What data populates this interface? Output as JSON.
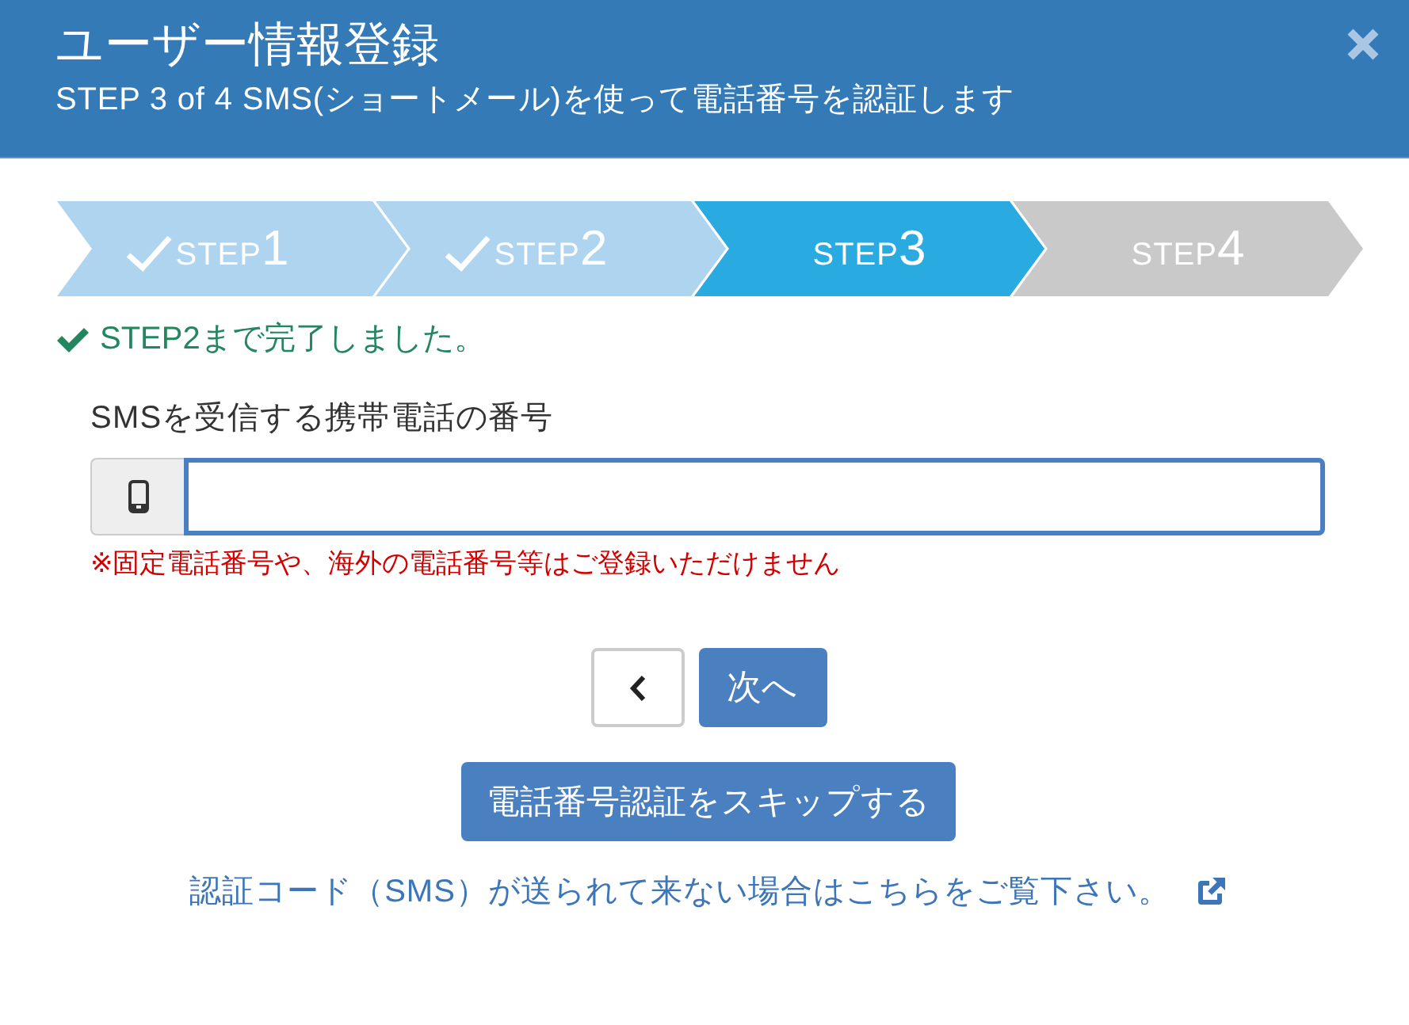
{
  "dialog": {
    "title": "ユーザー情報登録",
    "subtitle": "STEP 3 of 4 SMS(ショートメール)を使って電話番号を認証します"
  },
  "steps": [
    {
      "label": "STEP",
      "number": "1",
      "completed": true,
      "selected": false
    },
    {
      "label": "STEP",
      "number": "2",
      "completed": true,
      "selected": false
    },
    {
      "label": "STEP",
      "number": "3",
      "completed": false,
      "selected": true
    },
    {
      "label": "STEP",
      "number": "4",
      "completed": false,
      "selected": false
    }
  ],
  "status_message": "STEP2まで完了しました。",
  "phone_field": {
    "label": "SMSを受信する携帯電話の番号",
    "focused": true,
    "note": "※固定電話番号や、海外の電話番号等はご登録いただけません"
  },
  "buttons": [
    {
      "kind": "back"
    },
    {
      "kind": "next",
      "label": "次へ"
    }
  ],
  "skip_button": "電話番号認証をスキップする",
  "help_link": "認証コード（SMS）が送られて来ない場合はこちらをご覧下さい。"
}
